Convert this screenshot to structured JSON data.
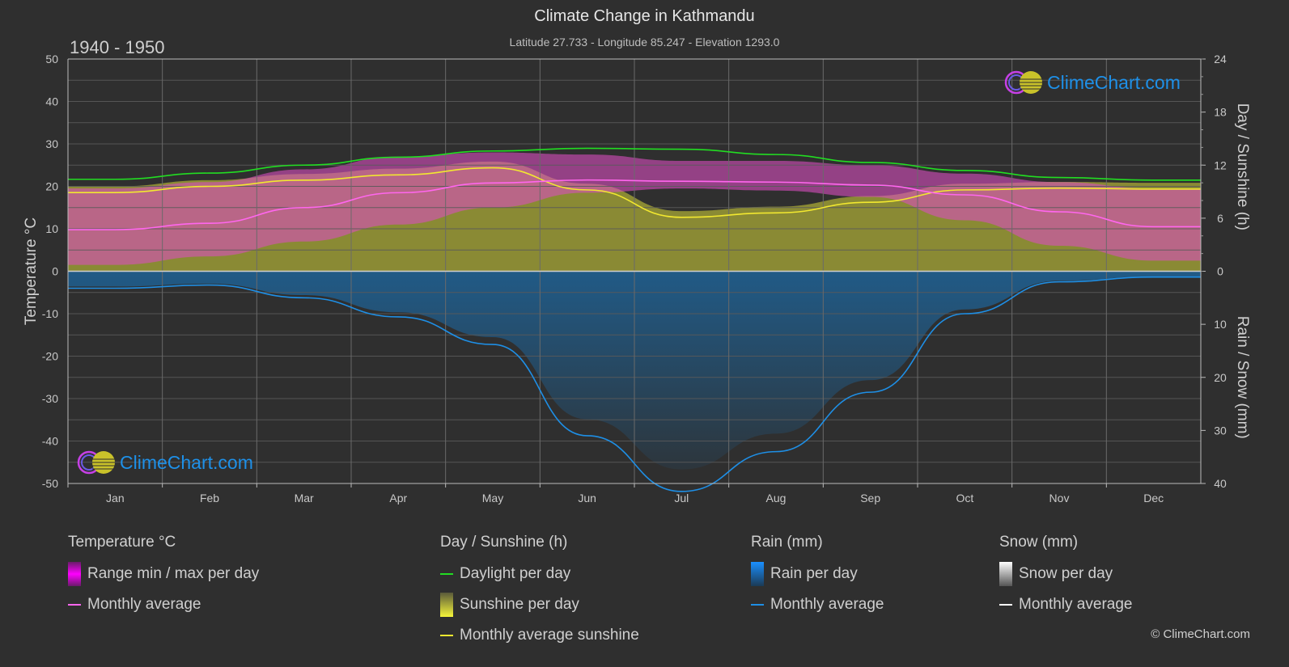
{
  "header": {
    "title": "Climate Change in Kathmandu",
    "subtitle": "Latitude 27.733 - Longitude 85.247 - Elevation 1293.0",
    "period": "1940 - 1950"
  },
  "logo": {
    "text": "ClimeChart.com"
  },
  "copyright": "© ClimeChart.com",
  "colors": {
    "background": "#2f2f2f",
    "temp_avg": "#ff66ee",
    "temp_range": "#d94fc0",
    "daylight": "#22dd22",
    "sunshine_avg": "#f2e830",
    "sunshine_fill": "#8f8f35",
    "rain_avg": "#1e8fe6",
    "rain_fill": "#1e5b8a",
    "snow_avg": "#ffffff"
  },
  "legend": {
    "groups": [
      {
        "title": "Temperature °C",
        "items": [
          {
            "label": "Range min / max per day",
            "kind": "bar",
            "swatch": "temp_range"
          },
          {
            "label": "Monthly average",
            "kind": "line",
            "swatch": "temp_avg"
          }
        ]
      },
      {
        "title": "Day / Sunshine (h)",
        "items": [
          {
            "label": "Daylight per day",
            "kind": "line",
            "swatch": "daylight"
          },
          {
            "label": "Sunshine per day",
            "kind": "bar",
            "swatch": "sunshine"
          },
          {
            "label": "Monthly average sunshine",
            "kind": "line",
            "swatch": "sunshine_avg"
          }
        ]
      },
      {
        "title": "Rain (mm)",
        "items": [
          {
            "label": "Rain per day",
            "kind": "bar",
            "swatch": "rain"
          },
          {
            "label": "Monthly average",
            "kind": "line",
            "swatch": "rain_avg"
          }
        ]
      },
      {
        "title": "Snow (mm)",
        "items": [
          {
            "label": "Snow per day",
            "kind": "bar",
            "swatch": "snow"
          },
          {
            "label": "Monthly average",
            "kind": "line",
            "swatch": "snow_avg"
          }
        ]
      }
    ]
  },
  "chart_data": {
    "type": "line",
    "title": "Climate Change in Kathmandu",
    "subtitle": "Latitude 27.733 - Longitude 85.247 - Elevation 1293.0",
    "period": "1940 - 1950",
    "categories": [
      "Jan",
      "Feb",
      "Mar",
      "Apr",
      "May",
      "Jun",
      "Jul",
      "Aug",
      "Sep",
      "Oct",
      "Nov",
      "Dec"
    ],
    "axes": {
      "left": {
        "label": "Temperature °C",
        "range": [
          -50,
          50
        ],
        "ticks": [
          50,
          40,
          30,
          20,
          10,
          0,
          -10,
          -20,
          -30,
          -40,
          -50
        ]
      },
      "right_top": {
        "label": "Day / Sunshine (h)",
        "range": [
          0,
          24
        ],
        "ticks": [
          24,
          18,
          12,
          6,
          0
        ]
      },
      "right_bottom": {
        "label": "Rain / Snow (mm)",
        "range": [
          0,
          40
        ],
        "ticks": [
          0,
          10,
          20,
          30,
          40
        ]
      }
    },
    "grid": true,
    "series": [
      {
        "name": "Temperature monthly average",
        "axis": "left",
        "unit": "°C",
        "values": [
          9.8,
          11.3,
          15.0,
          18.5,
          20.8,
          21.5,
          21.2,
          21.0,
          20.3,
          18.0,
          14.0,
          10.5
        ]
      },
      {
        "name": "Temperature daily max (approx. upper range)",
        "axis": "left",
        "unit": "°C",
        "values": [
          19.5,
          21.0,
          24.0,
          27.0,
          28.0,
          27.5,
          26.0,
          26.0,
          25.0,
          23.0,
          21.0,
          19.5
        ]
      },
      {
        "name": "Temperature daily min (approx. lower range)",
        "axis": "left",
        "unit": "°C",
        "values": [
          1.5,
          3.5,
          7.0,
          11.0,
          15.0,
          18.5,
          19.5,
          19.0,
          17.5,
          12.0,
          6.0,
          2.5
        ]
      },
      {
        "name": "Daylight per day",
        "axis": "right_top",
        "unit": "h",
        "values": [
          10.4,
          11.1,
          12.0,
          12.9,
          13.6,
          13.9,
          13.8,
          13.2,
          12.3,
          11.4,
          10.6,
          10.3
        ]
      },
      {
        "name": "Monthly average sunshine",
        "axis": "right_top",
        "unit": "h",
        "values": [
          8.9,
          9.6,
          10.3,
          10.9,
          11.7,
          9.2,
          6.1,
          6.6,
          7.8,
          9.2,
          9.4,
          9.3
        ]
      },
      {
        "name": "Rain monthly average",
        "axis": "right_bottom",
        "unit": "mm",
        "values": [
          3.2,
          2.6,
          5.0,
          8.6,
          13.8,
          31.0,
          41.5,
          34.0,
          22.8,
          8.0,
          2.0,
          1.1
        ]
      },
      {
        "name": "Snow monthly average",
        "axis": "right_bottom",
        "unit": "mm",
        "values": [
          0,
          0,
          0,
          0,
          0,
          0,
          0,
          0,
          0,
          0,
          0,
          0
        ]
      }
    ]
  }
}
